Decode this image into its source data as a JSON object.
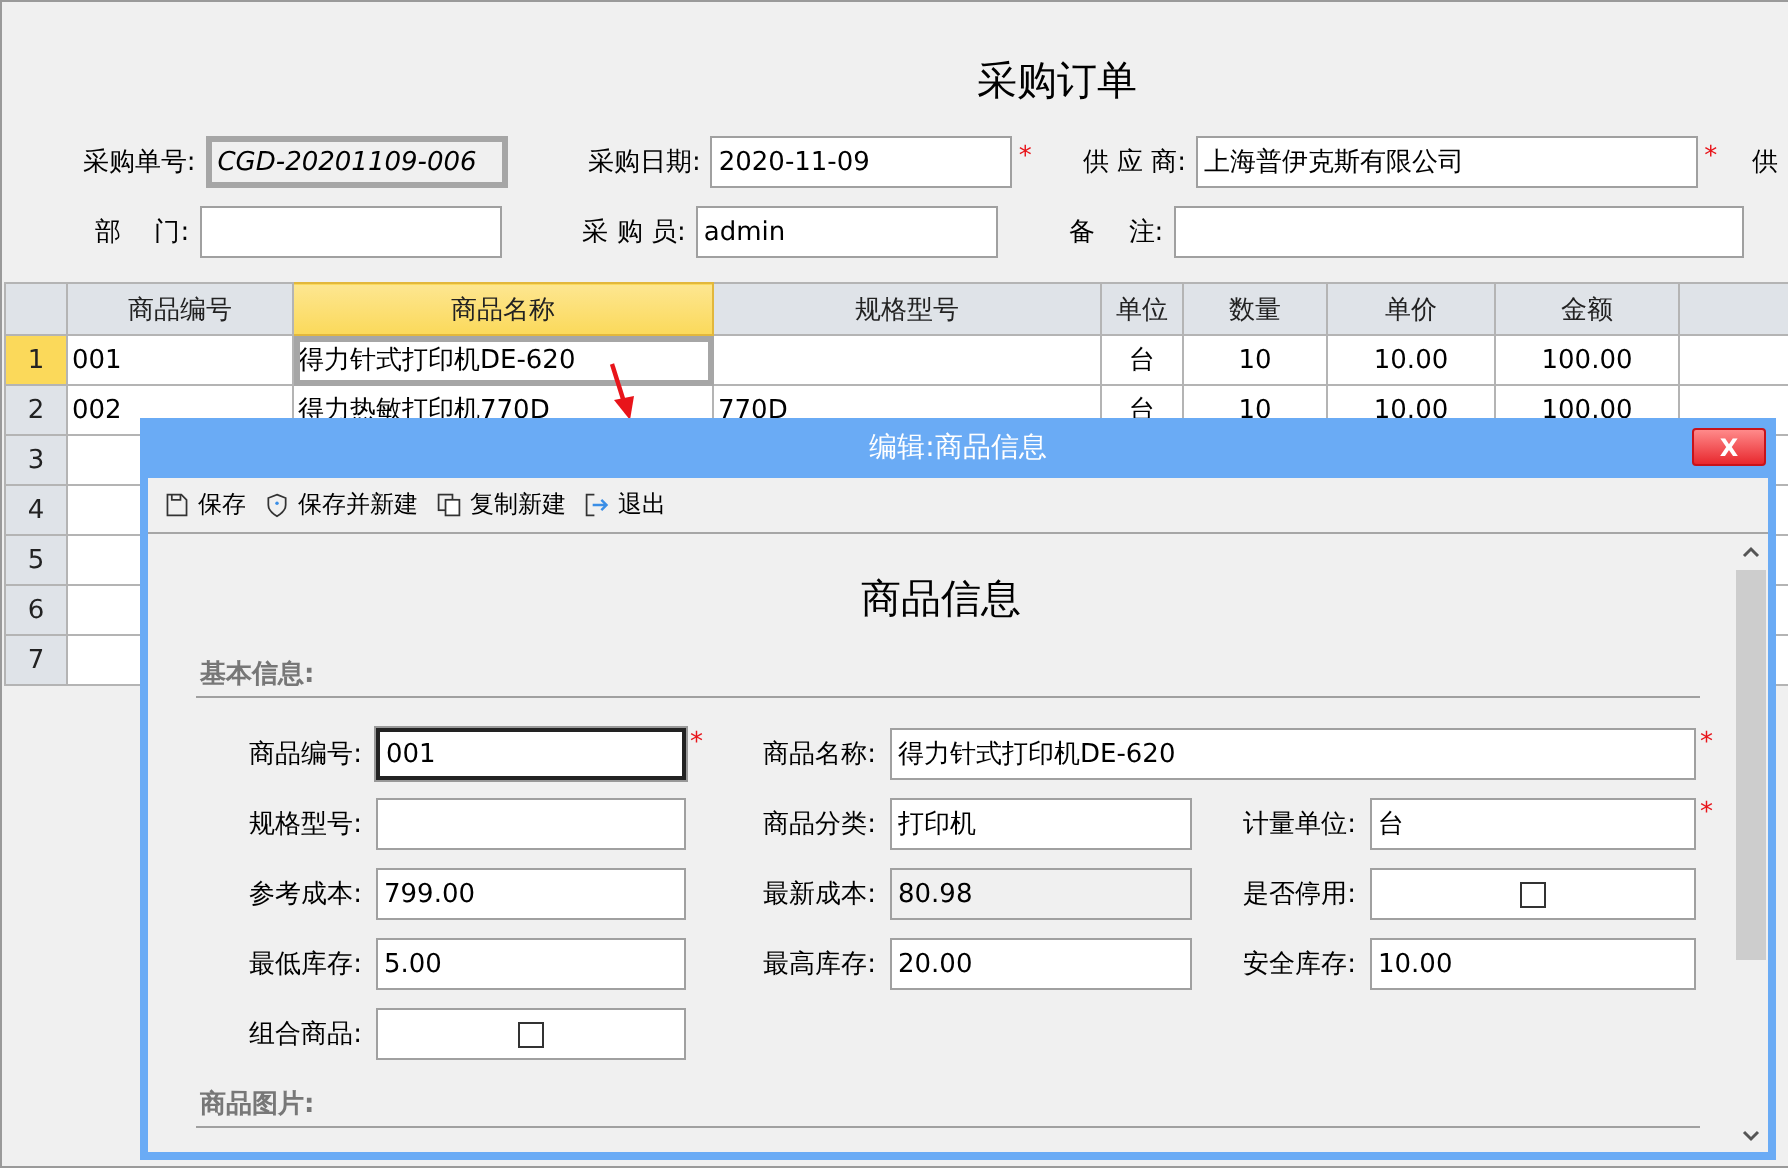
{
  "title": "采购订单",
  "header_rows": [
    [
      {
        "label": "采购单号:",
        "value": "CGD-20201109-006",
        "kind": "readonly"
      },
      {
        "label": "采购日期:",
        "value": "2020-11-09",
        "kind": "text",
        "mark": "*"
      },
      {
        "label": "供 应 商:",
        "value": "上海普伊克斯有限公司",
        "kind": "text",
        "mark": "*"
      },
      {
        "label": "供",
        "kind": "cut"
      }
    ],
    [
      {
        "label": "部    门:",
        "kind": "text"
      },
      {
        "label": "采 购 员:",
        "value": "admin",
        "kind": "text"
      },
      {
        "label": "备    注:",
        "kind": "text"
      }
    ]
  ],
  "table": {
    "columns": [
      {
        "label": "商品编号",
        "selected": false
      },
      {
        "label": "商品名称",
        "selected": true
      },
      {
        "label": "规格型号",
        "selected": false
      },
      {
        "label": "单位",
        "selected": false
      },
      {
        "label": "数量",
        "selected": false
      },
      {
        "label": "单价",
        "selected": false
      },
      {
        "label": "金额",
        "selected": false
      }
    ],
    "rows": [
      {
        "number": "1",
        "selected": true,
        "cells": [
          "001",
          "得力针式打印机DE-620",
          null,
          "台",
          "10",
          "10.00",
          "100.00"
        ]
      },
      {
        "number": "2",
        "selected": false,
        "cells": [
          "002",
          "得力热敏打印机770D",
          "770D",
          "台",
          "10",
          "10.00",
          "100.00"
        ]
      },
      {
        "number": "3",
        "selected": false
      },
      {
        "number": "4",
        "selected": false
      },
      {
        "number": "5",
        "selected": false
      },
      {
        "number": "6",
        "selected": false
      },
      {
        "number": "7",
        "selected": false
      }
    ]
  },
  "dialog": {
    "title": "编辑:商品信息",
    "close_label": "X",
    "toolbar": [
      {
        "label": "保存",
        "kind": "save"
      },
      {
        "label": "保存并新建",
        "kind": "shield"
      },
      {
        "label": "复制新建",
        "kind": "copy"
      },
      {
        "label": "退出",
        "kind": "exit"
      }
    ],
    "heading": "商品信息",
    "sections": [
      {
        "title": "基本信息:",
        "rows": [
          [
            {
              "label": "商品编号:",
              "value": "001",
              "kind": "text",
              "mark": "*",
              "focused": true
            },
            {
              "label": "商品名称:",
              "value": "得力针式打印机DE-620",
              "kind": "wide_text",
              "mark": "*",
              "focused": false
            }
          ],
          [
            {
              "label": "规格型号:",
              "kind": "text",
              "focused": false
            },
            {
              "label": "商品分类:",
              "value": "打印机",
              "kind": "text",
              "focused": false
            },
            {
              "label": "计量单位:",
              "value": "台",
              "kind": "text",
              "mark": "*",
              "focused": false
            }
          ],
          [
            {
              "label": "参考成本:",
              "value": "799.00",
              "kind": "text",
              "focused": false
            },
            {
              "label": "最新成本:",
              "value": "80.98",
              "kind": "readonly",
              "focused": false
            },
            {
              "label": "是否停用:",
              "kind": "checkbox",
              "checked": false
            }
          ],
          [
            {
              "label": "最低库存:",
              "value": "5.00",
              "kind": "text",
              "focused": false
            },
            {
              "label": "最高库存:",
              "value": "20.00",
              "kind": "text",
              "focused": false
            },
            {
              "label": "安全库存:",
              "value": "10.00",
              "kind": "text",
              "focused": false
            }
          ],
          [
            {
              "label": "组合商品:",
              "kind": "checkbox",
              "checked": false
            }
          ]
        ]
      },
      {
        "title": "商品图片:"
      }
    ]
  }
}
